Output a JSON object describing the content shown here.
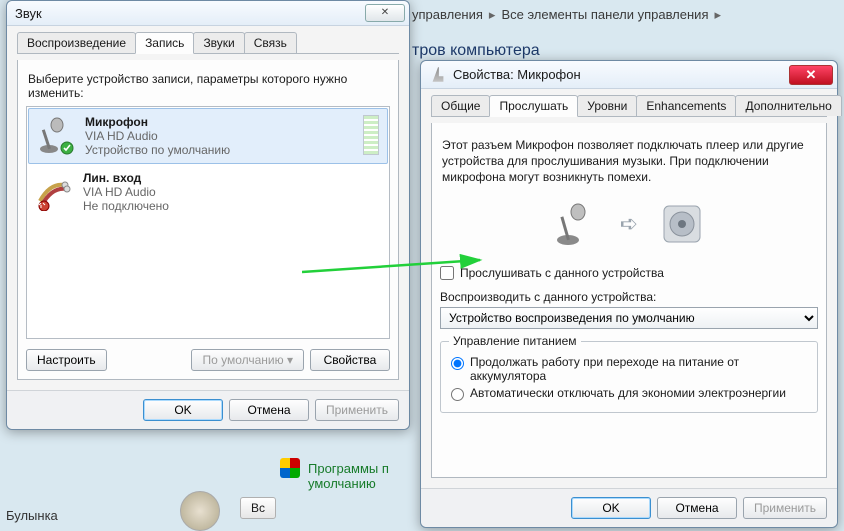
{
  "background": {
    "breadcrumb1": "управления",
    "breadcrumb2": "Все элементы панели управления",
    "heading": "тров компьютера",
    "programs_line1": "Программы п",
    "programs_line2": "умолчанию",
    "user_label": "Булынка",
    "user_button": "Вс"
  },
  "sound_window": {
    "title": "Звук",
    "tabs": {
      "playback": "Воспроизведение",
      "recording": "Запись",
      "sounds": "Звуки",
      "comm": "Связь"
    },
    "instruction": "Выберите устройство записи, параметры которого нужно изменить:",
    "devices": [
      {
        "name": "Микрофон",
        "driver": "VIA HD Audio",
        "status": "Устройство по умолчанию",
        "selected": true,
        "has_meter": true,
        "has_check": true
      },
      {
        "name": "Лин. вход",
        "driver": "VIA HD Audio",
        "status": "Не подключено",
        "selected": false,
        "has_meter": false,
        "has_check": false
      }
    ],
    "buttons": {
      "configure": "Настроить",
      "set_default": "По умолчанию",
      "properties": "Свойства",
      "ok": "OK",
      "cancel": "Отмена",
      "apply": "Применить"
    }
  },
  "props_window": {
    "title": "Свойства: Микрофон",
    "tabs": {
      "general": "Общие",
      "listen": "Прослушать",
      "levels": "Уровни",
      "enhance": "Enhancements",
      "advanced": "Дополнительно"
    },
    "description": "Этот разъем Микрофон позволяет подключать плеер или другие устройства для прослушивания музыки. При подключении микрофона могут возникнуть помехи.",
    "listen_checkbox": "Прослушивать с данного устройства",
    "playback_label": "Воспроизводить с данного устройства:",
    "playback_selected": "Устройство воспроизведения по умолчанию",
    "power_group": "Управление питанием",
    "power_opt1": "Продолжать работу при переходе на питание от аккумулятора",
    "power_opt2": "Автоматически отключать для экономии электроэнергии",
    "buttons": {
      "ok": "OK",
      "cancel": "Отмена",
      "apply": "Применить"
    }
  }
}
